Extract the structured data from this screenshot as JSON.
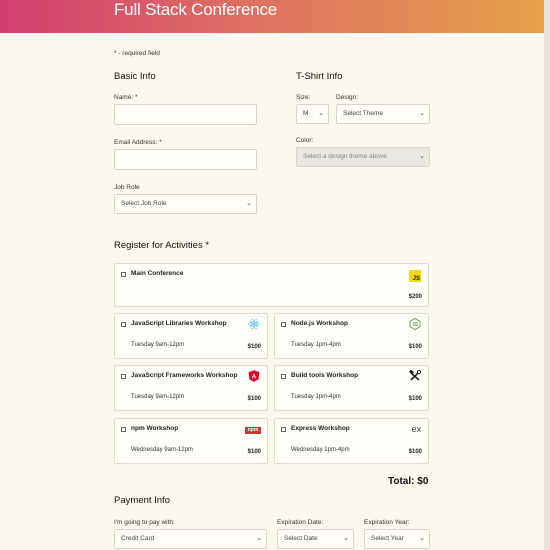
{
  "header": {
    "title": "Full Stack Conference"
  },
  "required_note": "* - required field",
  "basic_info": {
    "title": "Basic Info",
    "name_label": "Name: *",
    "email_label": "Email Address: *",
    "job_role_label": "Job Role",
    "job_role_value": "Select Job Role"
  },
  "tshirt": {
    "title": "T-Shirt Info",
    "size_label": "Size:",
    "size_value": "M",
    "design_label": "Design:",
    "design_value": "Select Theme",
    "color_label": "Color:",
    "color_value": "Select a design theme above"
  },
  "activities": {
    "title": "Register for Activities *",
    "items": [
      {
        "name": "Main Conference",
        "time": "",
        "price": "$200",
        "icon": "js-icon"
      },
      {
        "name": "JavaScript Libraries Workshop",
        "time": "Tuesday 9am-12pm",
        "price": "$100",
        "icon": "react-icon"
      },
      {
        "name": "Node.js Workshop",
        "time": "Tuesday 1pm-4pm",
        "price": "$100",
        "icon": "nodejs-icon"
      },
      {
        "name": "JavaScript Frameworks Workshop",
        "time": "Tuesday 9am-12pm",
        "price": "$100",
        "icon": "angular-icon"
      },
      {
        "name": "Build tools Workshop",
        "time": "Tuesday 1pm-4pm",
        "price": "$100",
        "icon": "tools-icon"
      },
      {
        "name": "npm Workshop",
        "time": "Wednesday 9am-12pm",
        "price": "$100",
        "icon": "npm-icon"
      },
      {
        "name": "Express Workshop",
        "time": "Wednesday 1pm-4pm",
        "price": "$100",
        "icon": "express-icon"
      }
    ],
    "total": "Total: $0"
  },
  "payment": {
    "title": "Payment Info",
    "method_label": "I'm going to pay with:",
    "method_value": "Credit Card",
    "exp_date_label": "Expiration Date:",
    "exp_date_value": "Select Date",
    "exp_year_label": "Expiration Year:",
    "exp_year_value": "Select Year"
  },
  "icon_text": {
    "js": "JS",
    "npm": "npm",
    "express": "ex",
    "angular": "A"
  },
  "colors": {
    "accent_start": "#d13f72",
    "accent_end": "#e6a24a",
    "background": "#fcf8f0"
  }
}
